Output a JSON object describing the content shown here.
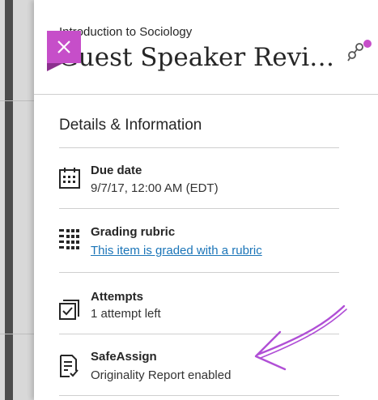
{
  "header": {
    "course_name": "Introduction to Sociology",
    "item_title": "Guest Speaker Revi…",
    "close_icon": "close-icon",
    "header_icon": "rubric-toggle-icon"
  },
  "details": {
    "heading": "Details & Information",
    "due_date": {
      "label": "Due date",
      "value": "9/7/17, 12:00 AM (EDT)",
      "icon": "calendar-icon"
    },
    "grading_rubric": {
      "label": "Grading rubric",
      "link": "This item is graded with a rubric",
      "icon": "rubric-grid-icon"
    },
    "attempts": {
      "label": "Attempts",
      "value": "1 attempt left",
      "icon": "attempts-icon"
    },
    "safeassign": {
      "label": "SafeAssign",
      "value": "Originality Report enabled",
      "icon": "safeassign-icon"
    }
  },
  "colors": {
    "accent": "#c64ec9",
    "link": "#1b75b8",
    "annotation": "#b04fd6"
  }
}
